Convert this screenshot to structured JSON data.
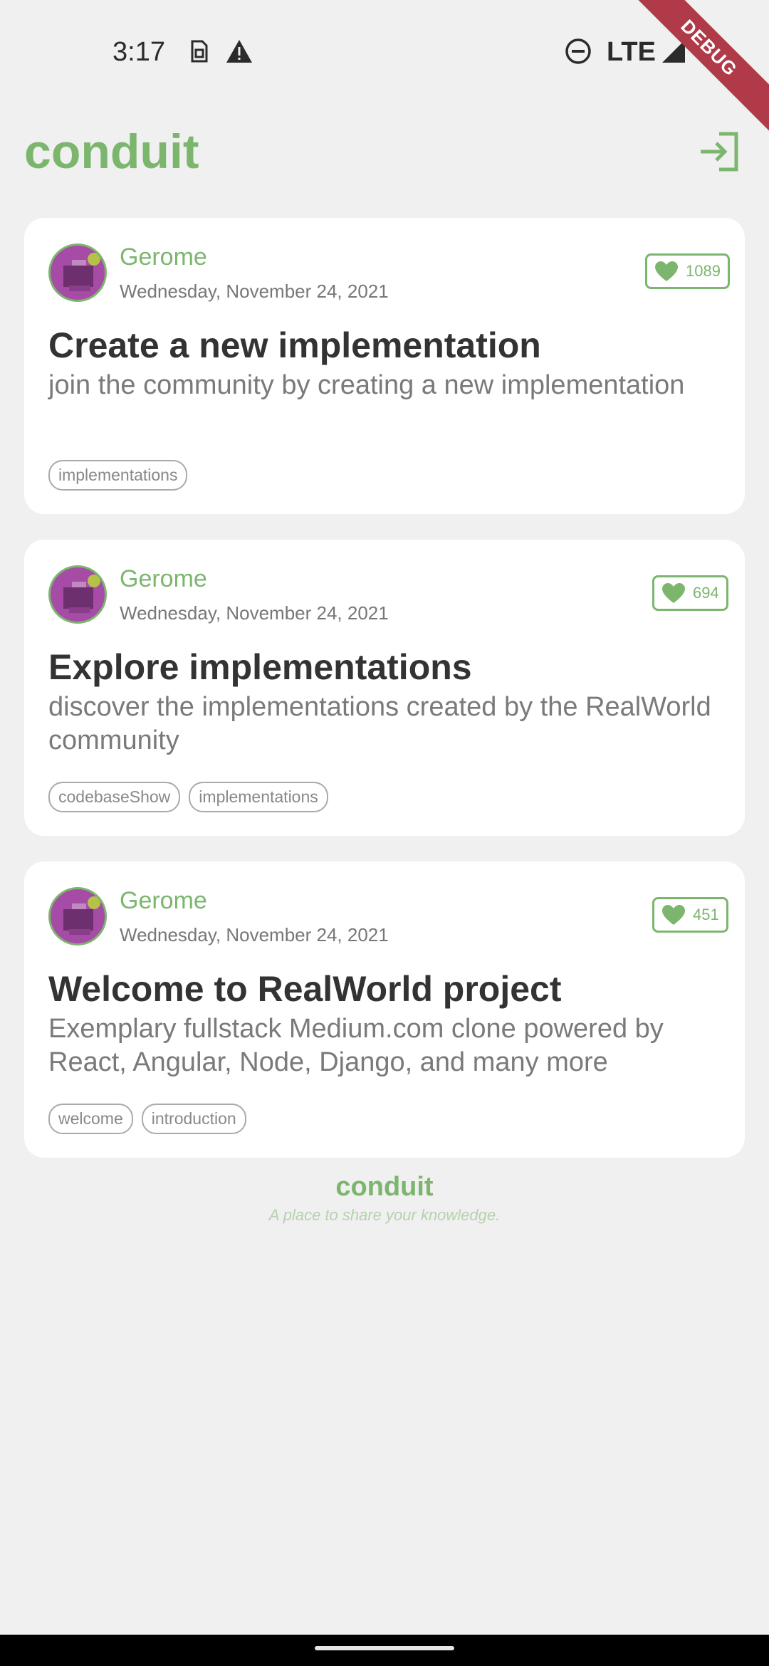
{
  "status_bar": {
    "time": "3:17",
    "network": "LTE",
    "icons": [
      "sim-card-icon",
      "warning-icon",
      "do-not-disturb-icon",
      "signal-icon",
      "battery-charging-icon"
    ]
  },
  "debug_banner": "DEBUG",
  "app_bar": {
    "title": "conduit",
    "login_icon": "login-icon"
  },
  "colors": {
    "brand": "#7cb66e",
    "background": "#f0f0f0",
    "card": "#ffffff",
    "debug": "#b03a48"
  },
  "articles": [
    {
      "author": "Gerome",
      "date": "Wednesday, November 24, 2021",
      "likes": "1089",
      "title": "Create a new implementation",
      "description": "join the community by creating a new implementation",
      "tags": [
        "implementations"
      ]
    },
    {
      "author": "Gerome",
      "date": "Wednesday, November 24, 2021",
      "likes": "694",
      "title": "Explore implementations",
      "description": "discover the implementations created by the RealWorld community",
      "tags": [
        "codebaseShow",
        "implementations"
      ]
    },
    {
      "author": "Gerome",
      "date": "Wednesday, November 24, 2021",
      "likes": "451",
      "title": "Welcome to RealWorld project",
      "description": "Exemplary fullstack Medium.com clone powered by React, Angular, Node, Django, and many more",
      "tags": [
        "welcome",
        "introduction"
      ]
    }
  ],
  "footer": {
    "brand": "conduit",
    "tagline": "A place to share your knowledge."
  }
}
